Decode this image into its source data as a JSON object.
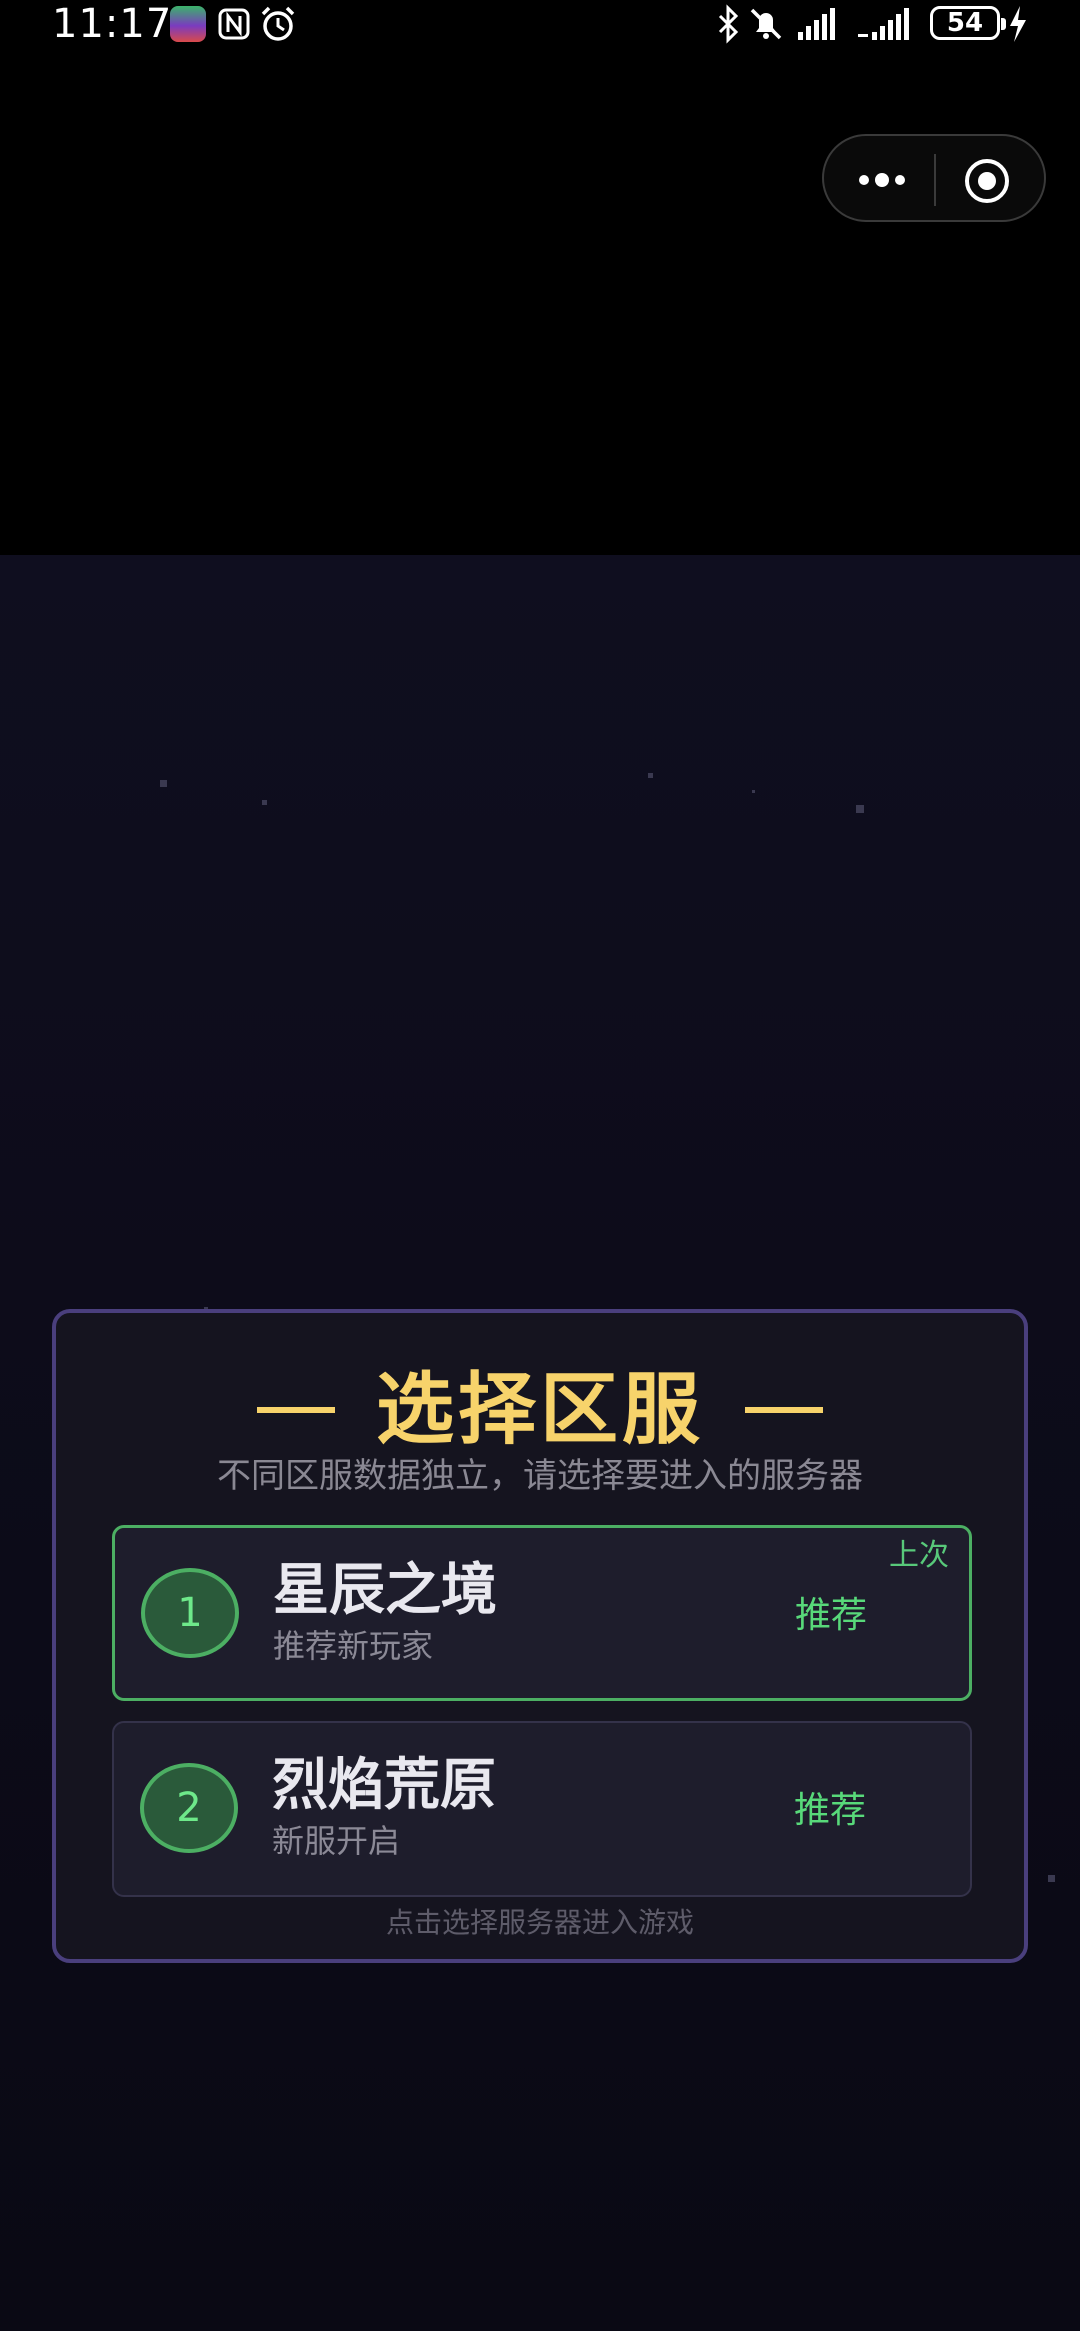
{
  "status_bar": {
    "time": "11:17",
    "battery": "54"
  },
  "dialog": {
    "title": "选择区服",
    "subtitle": "不同区服数据独立，请选择要进入的服务器",
    "servers": [
      {
        "number": "1",
        "name": "星辰之境",
        "description": "推荐新玩家",
        "tag": "推荐",
        "last_badge": "上次",
        "selected": true
      },
      {
        "number": "2",
        "name": "烈焰荒原",
        "description": "新服开启",
        "tag": "推荐",
        "selected": false
      }
    ],
    "footer": "点击选择服务器进入游戏"
  },
  "colors": {
    "title": "#f7d36b",
    "accent_green": "#4caf63",
    "dialog_border": "#4a3f7d",
    "background": "#0f0e1f"
  },
  "icons": [
    "nfc-icon",
    "alarm-icon",
    "bluetooth-icon",
    "mute-icon",
    "signal-icon",
    "charging-icon",
    "more-icon",
    "close-target-icon"
  ]
}
